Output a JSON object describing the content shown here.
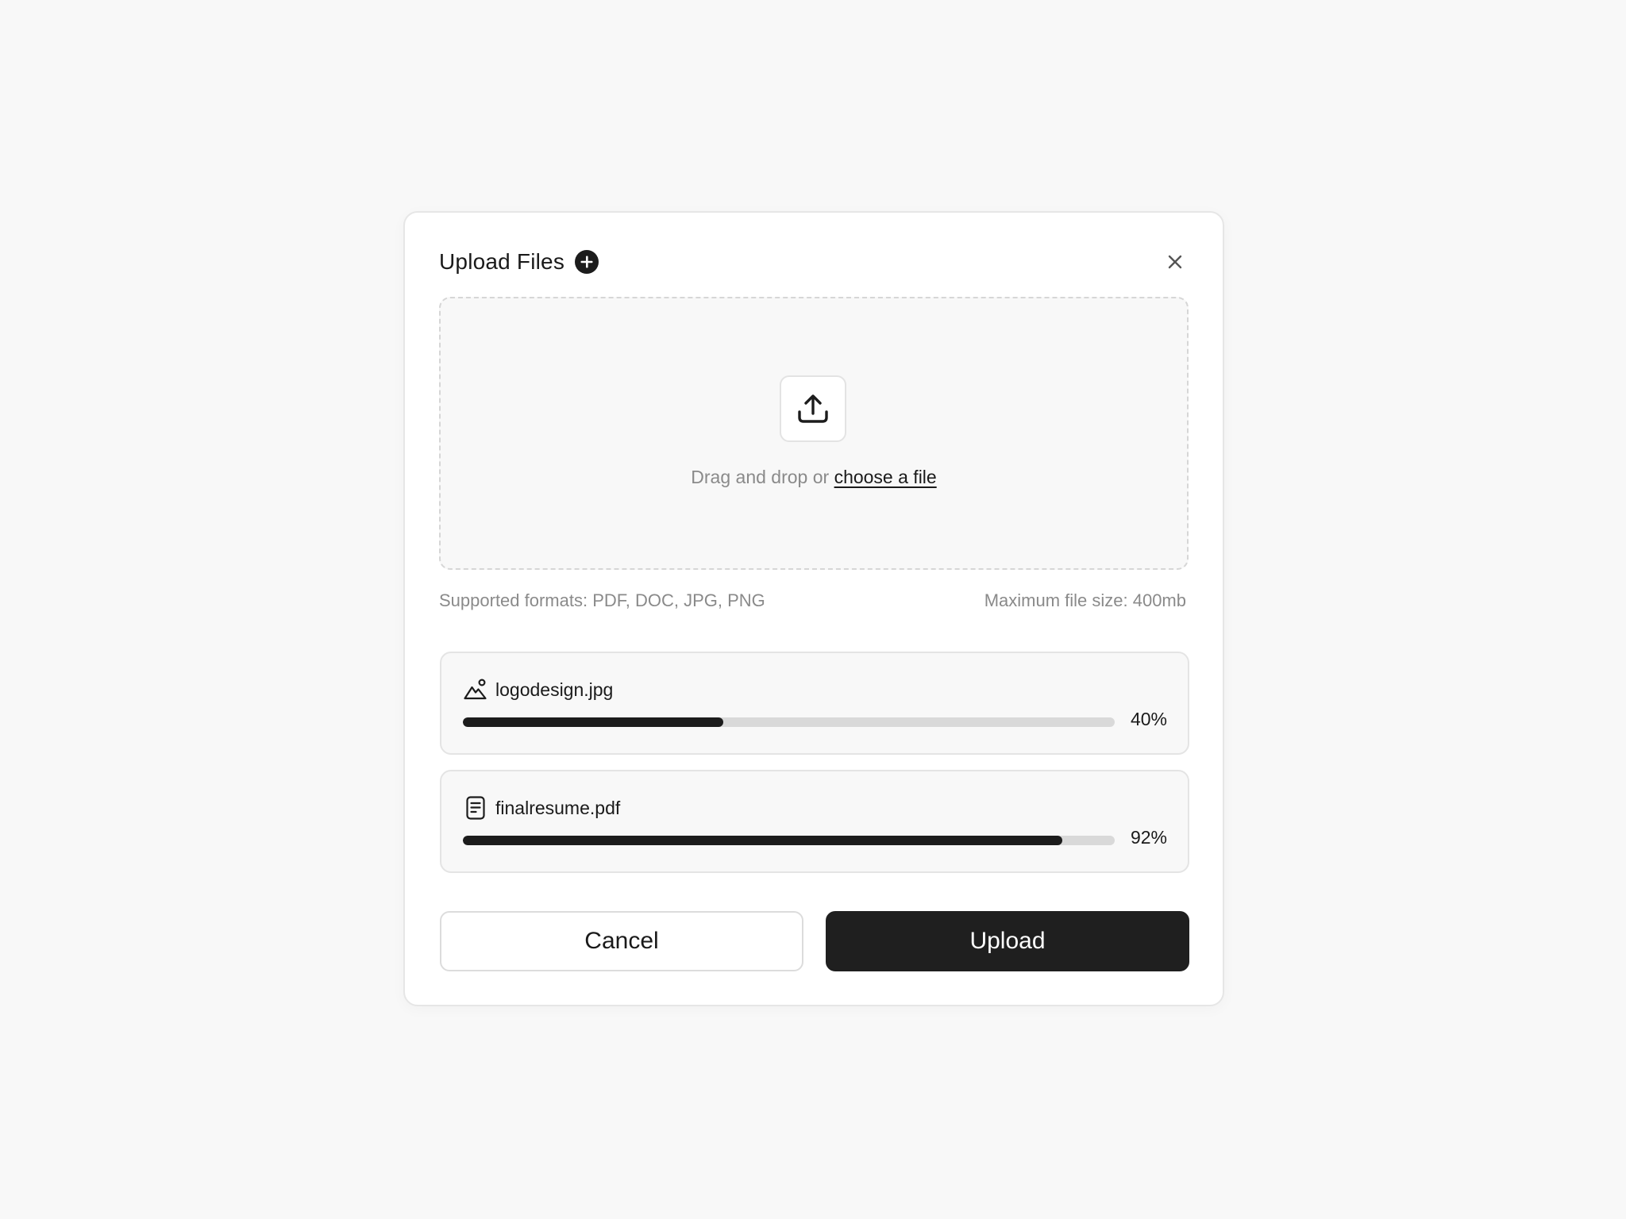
{
  "dialog": {
    "title": "Upload Files",
    "add_icon": "plus-circle-icon",
    "close_icon": "close-icon"
  },
  "dropzone": {
    "icon": "upload-icon",
    "prompt": "Drag and drop or ",
    "link_label": "choose a file"
  },
  "meta": {
    "supported_formats": "Supported formats: PDF, DOC, JPG, PNG",
    "max_size": "Maximum file size: 400mb"
  },
  "files": [
    {
      "name": "logodesign.jpg",
      "icon": "image-file-icon",
      "progress": 0.4,
      "percent_label": "40%"
    },
    {
      "name": "finalresume.pdf",
      "icon": "document-file-icon",
      "progress": 0.92,
      "percent_label": "92%"
    }
  ],
  "actions": {
    "cancel_label": "Cancel",
    "upload_label": "Upload"
  },
  "colors": {
    "background": "#f8f8f8",
    "surface": "#ffffff",
    "primary": "#1f1f1f",
    "muted_text": "#8a8a8a",
    "progress_track": "#d9d9d9"
  }
}
